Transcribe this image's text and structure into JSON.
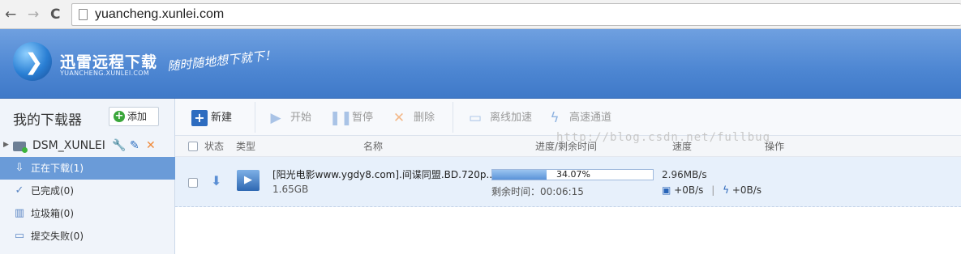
{
  "browser": {
    "back": "←",
    "forward": "→",
    "reload": "C",
    "url": "yuancheng.xunlei.com"
  },
  "banner": {
    "brand": "迅雷远程下载",
    "brand_sub": "YUANCHENG.XUNLEI.COM",
    "slogan": "随时随地想下就下！"
  },
  "sidebar": {
    "title": "我的下载器",
    "add_label": "添加",
    "device": {
      "name": "DSM_XUNLEI"
    },
    "items": [
      {
        "label": "正在下载(1)",
        "icon": "download-arrow-icon",
        "glyph": "⇩",
        "active": true
      },
      {
        "label": "已完成(0)",
        "icon": "checkmark-icon",
        "glyph": "✓",
        "active": false
      },
      {
        "label": "垃圾箱(0)",
        "icon": "trash-icon",
        "glyph": "▥",
        "active": false
      },
      {
        "label": "提交失败(0)",
        "icon": "document-icon",
        "glyph": "▭",
        "active": false
      }
    ]
  },
  "toolbar": {
    "new": "新建",
    "start": "开始",
    "pause": "暂停",
    "delete": "删除",
    "offline": "离线加速",
    "highspeed": "高速通道"
  },
  "watermark": "http://blog.csdn.net/fullbug",
  "table": {
    "headers": {
      "status": "状态",
      "type": "类型",
      "name": "名称",
      "progress": "进度/剩余时间",
      "speed": "速度",
      "ops": "操作"
    },
    "rows": [
      {
        "name": "[阳光电影www.ygdy8.com].间谍同盟.BD.720p...",
        "size": "1.65GB",
        "progress_pct": 34.07,
        "progress_label": "34.07%",
        "remaining": "剩余时间：00:06:15",
        "speed": "2.96MB/s",
        "offline_speed": "+0B/s",
        "sep": "|",
        "highspeed_speed": "+0B/s"
      }
    ]
  },
  "colors": {
    "accent": "#4d86d2",
    "active_item": "#6a9bd8",
    "delete_icon": "#f08a3a",
    "row_bg": "#e7f0fb"
  }
}
